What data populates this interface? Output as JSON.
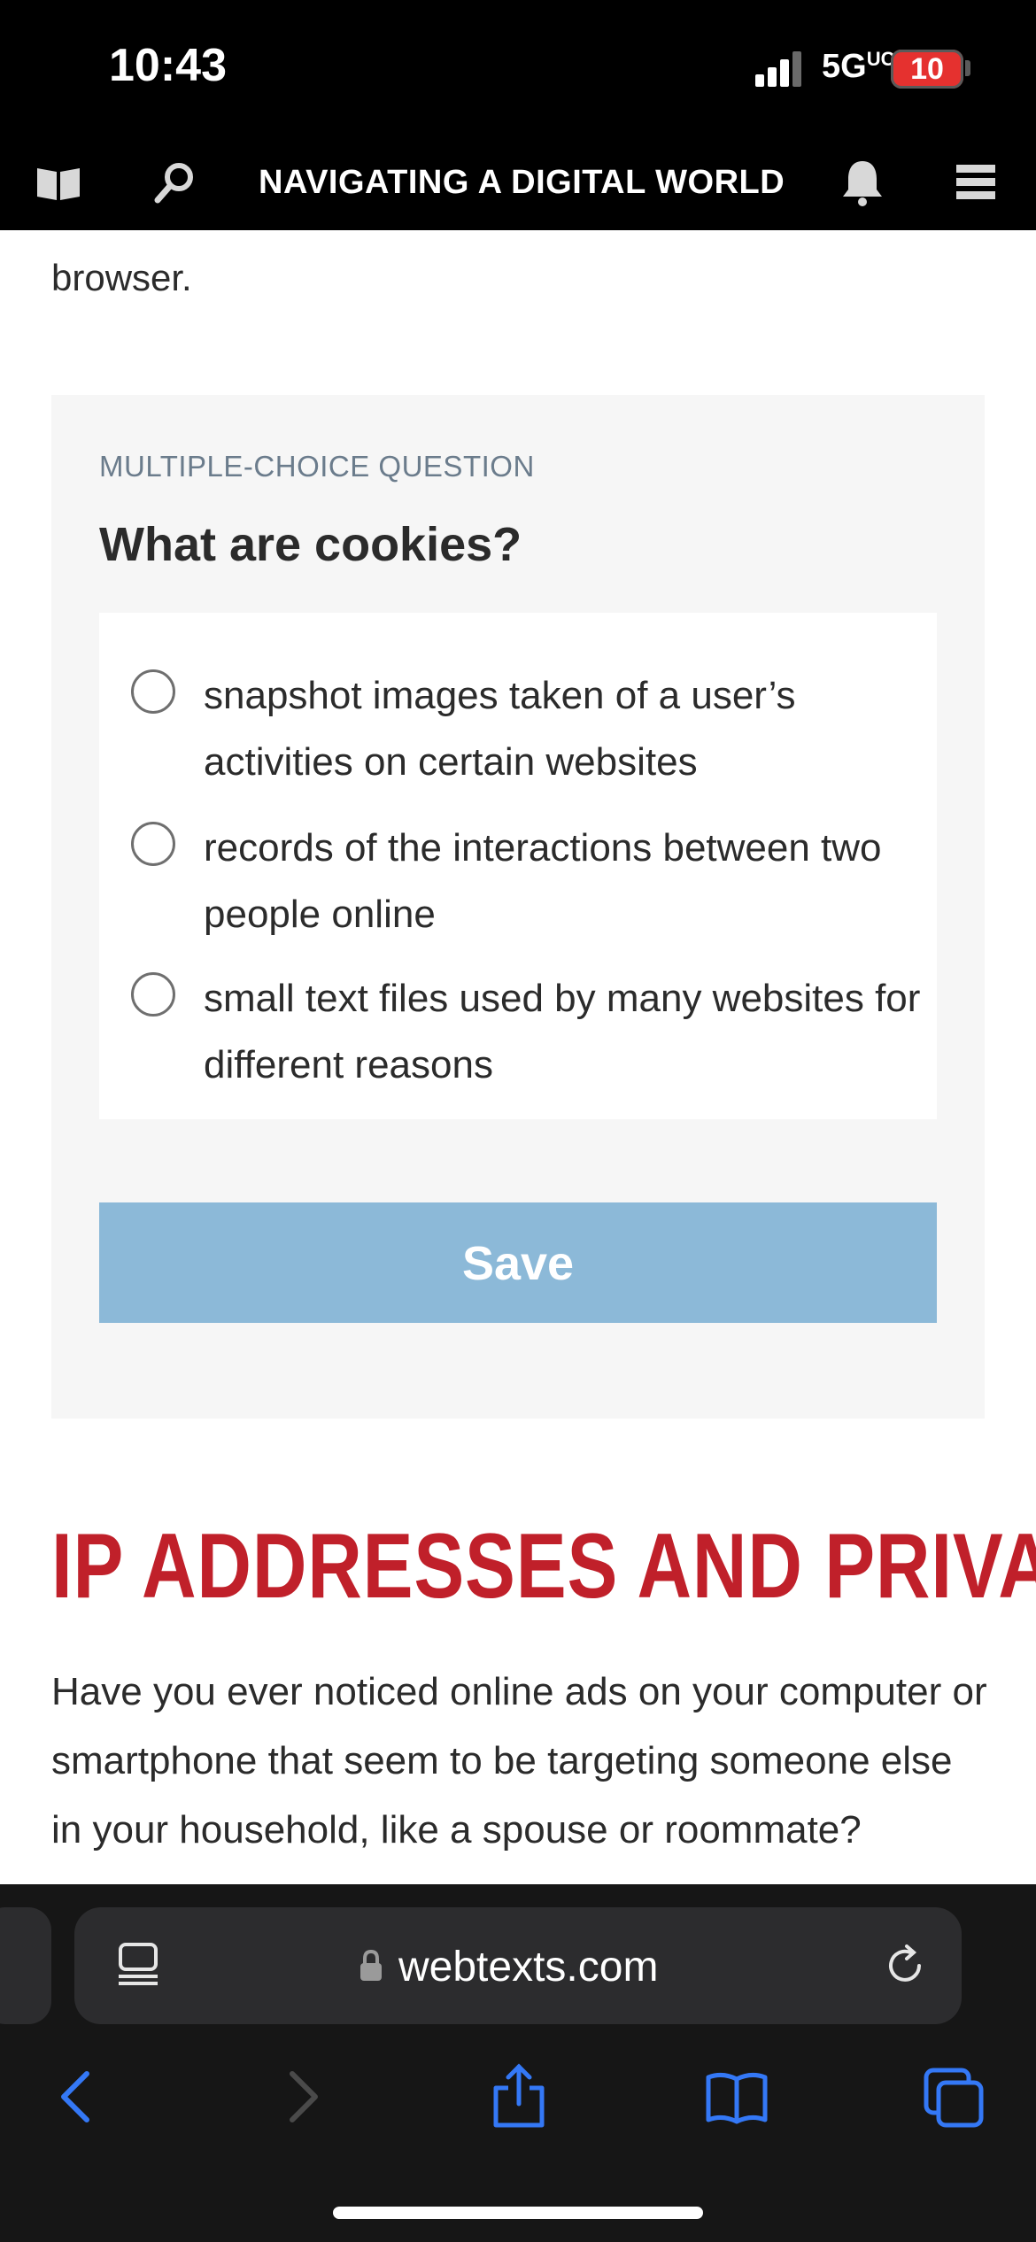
{
  "status_bar": {
    "time": "10:43",
    "network": "5G",
    "network_suffix": "UC",
    "battery": "10"
  },
  "header": {
    "title": "NAVIGATING A DIGITAL WORLD",
    "icons": [
      "book-icon",
      "search-icon",
      "bell-icon",
      "menu-icon"
    ]
  },
  "content": {
    "prev_text": "browser.",
    "question": {
      "kicker": "MULTIPLE-CHOICE QUESTION",
      "title": "What are cookies?",
      "options": [
        {
          "label": "snapshot images taken of a user’s activities on certain websites",
          "selected": false
        },
        {
          "label": "records of the interactions between two people online",
          "selected": false
        },
        {
          "label": "small text files used by many websites for different reasons",
          "selected": false
        }
      ],
      "save_label": "Save"
    },
    "section_heading": "IP ADDRESSES AND PRIVACY",
    "paragraph": "Have you ever noticed online ads on your computer or smartphone that seem to be targeting someone else in your household, like a spouse or roommate?"
  },
  "browser": {
    "url": "webtexts.com",
    "icons": [
      "reader-icon",
      "lock-icon",
      "reload-icon",
      "back-icon",
      "forward-icon",
      "share-icon",
      "bookmarks-icon",
      "tabs-icon"
    ]
  },
  "colors": {
    "accent_red": "#c0202a",
    "save_button": "#8cb9d8",
    "chat_bubble": "#7f9a2c",
    "browser_blue": "#3478f6"
  }
}
